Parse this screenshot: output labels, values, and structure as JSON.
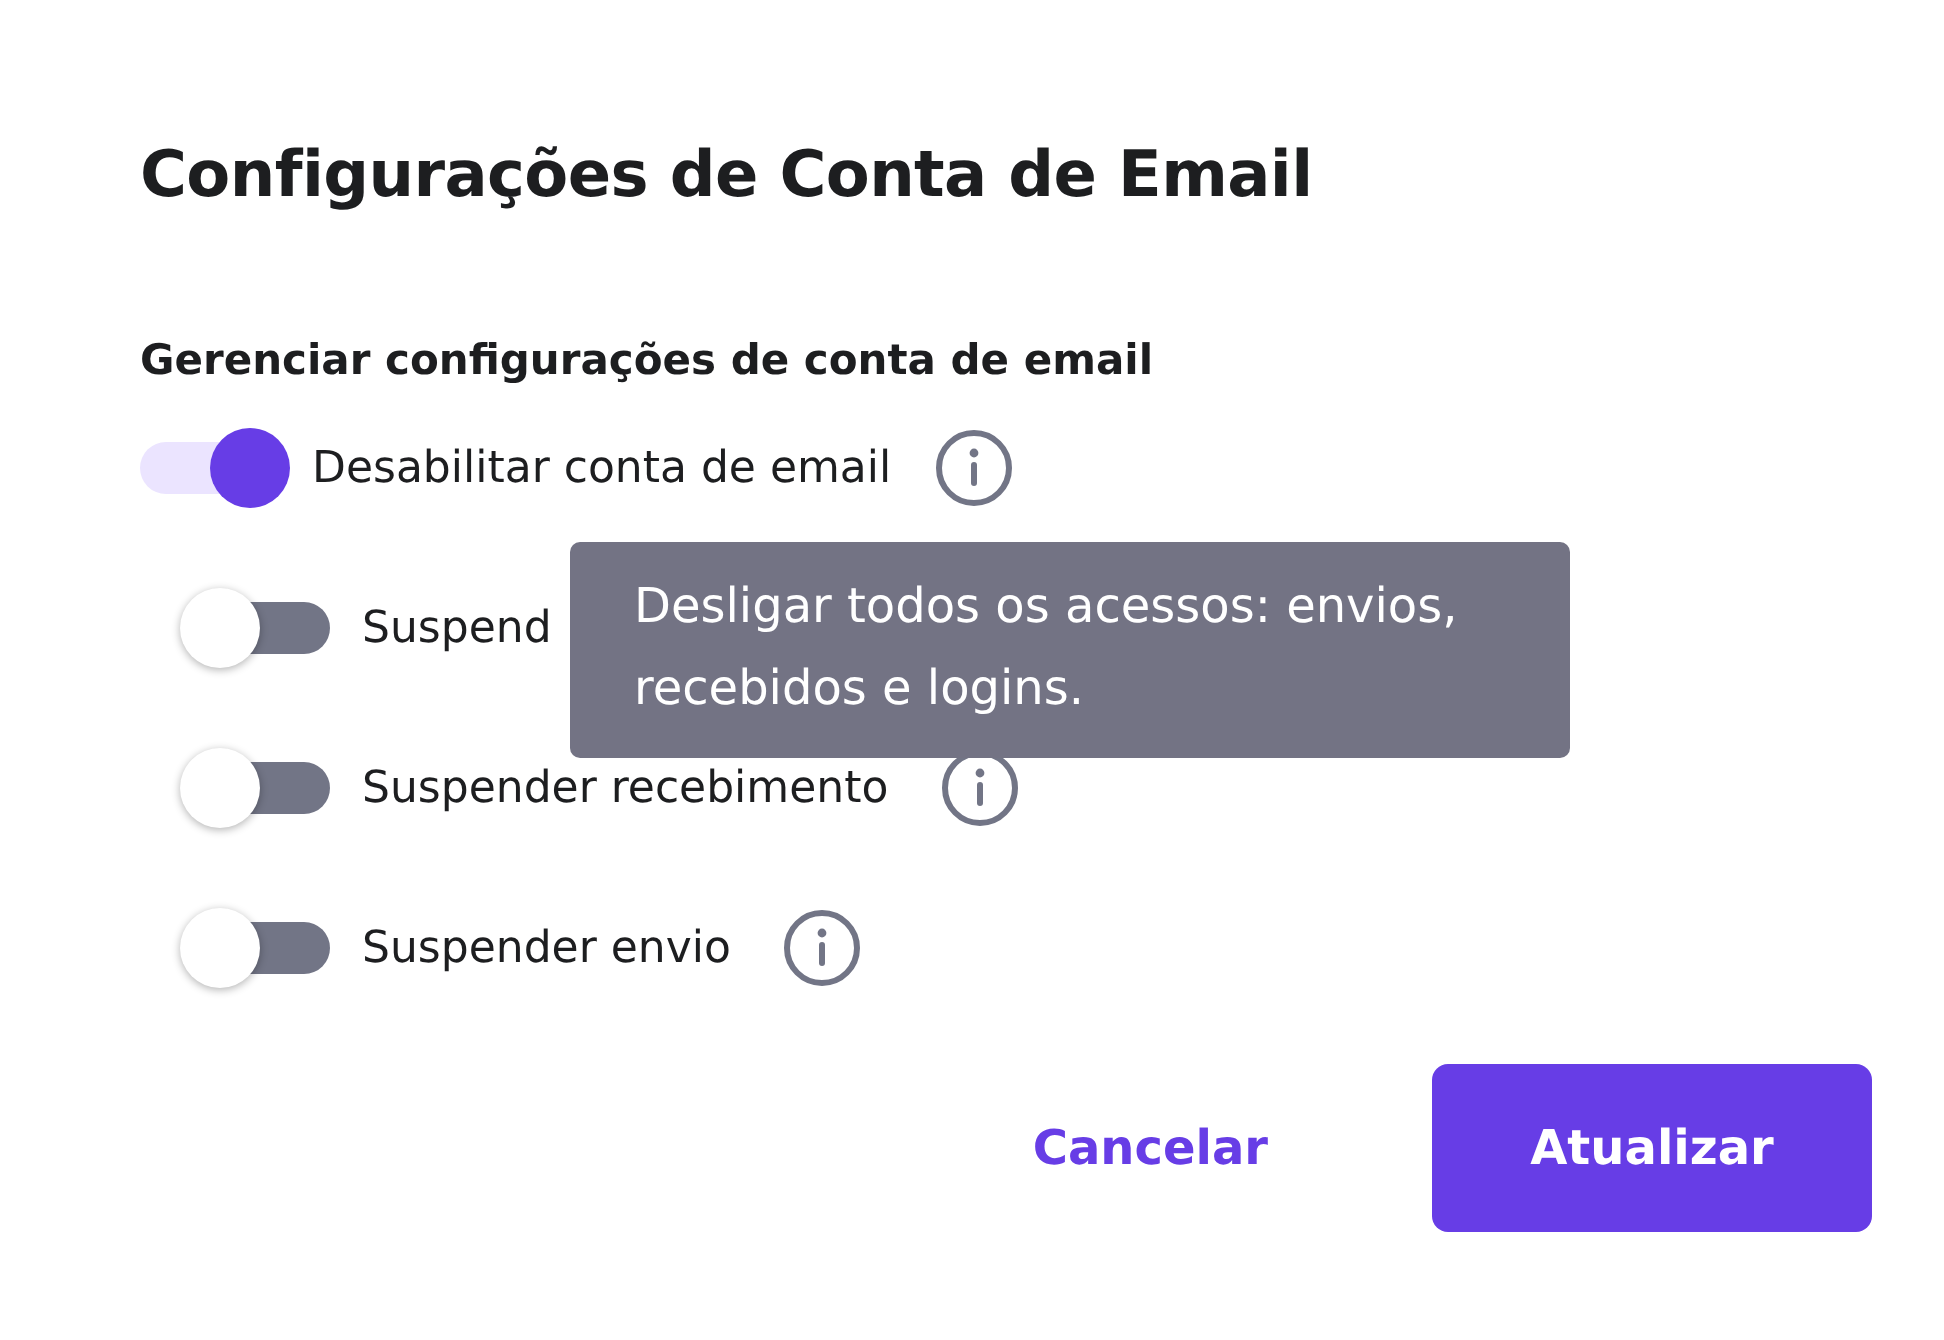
{
  "title": "Configurações de Conta de Email",
  "section_title": "Gerenciar configurações de conta de email",
  "options": [
    {
      "label": "Desabilitar conta de email",
      "on": true,
      "info": true,
      "nested": false
    },
    {
      "label": "Suspend",
      "on": false,
      "info": false,
      "nested": true
    },
    {
      "label": "Suspender recebimento",
      "on": false,
      "info": true,
      "nested": true
    },
    {
      "label": "Suspender envio",
      "on": false,
      "info": true,
      "nested": true
    }
  ],
  "tooltip": {
    "text": "Desligar todos os acessos: envios, recebidos e logins."
  },
  "buttons": [
    {
      "label": "Cancelar",
      "kind": "text"
    },
    {
      "label": "Atualizar",
      "kind": "primary"
    }
  ]
}
